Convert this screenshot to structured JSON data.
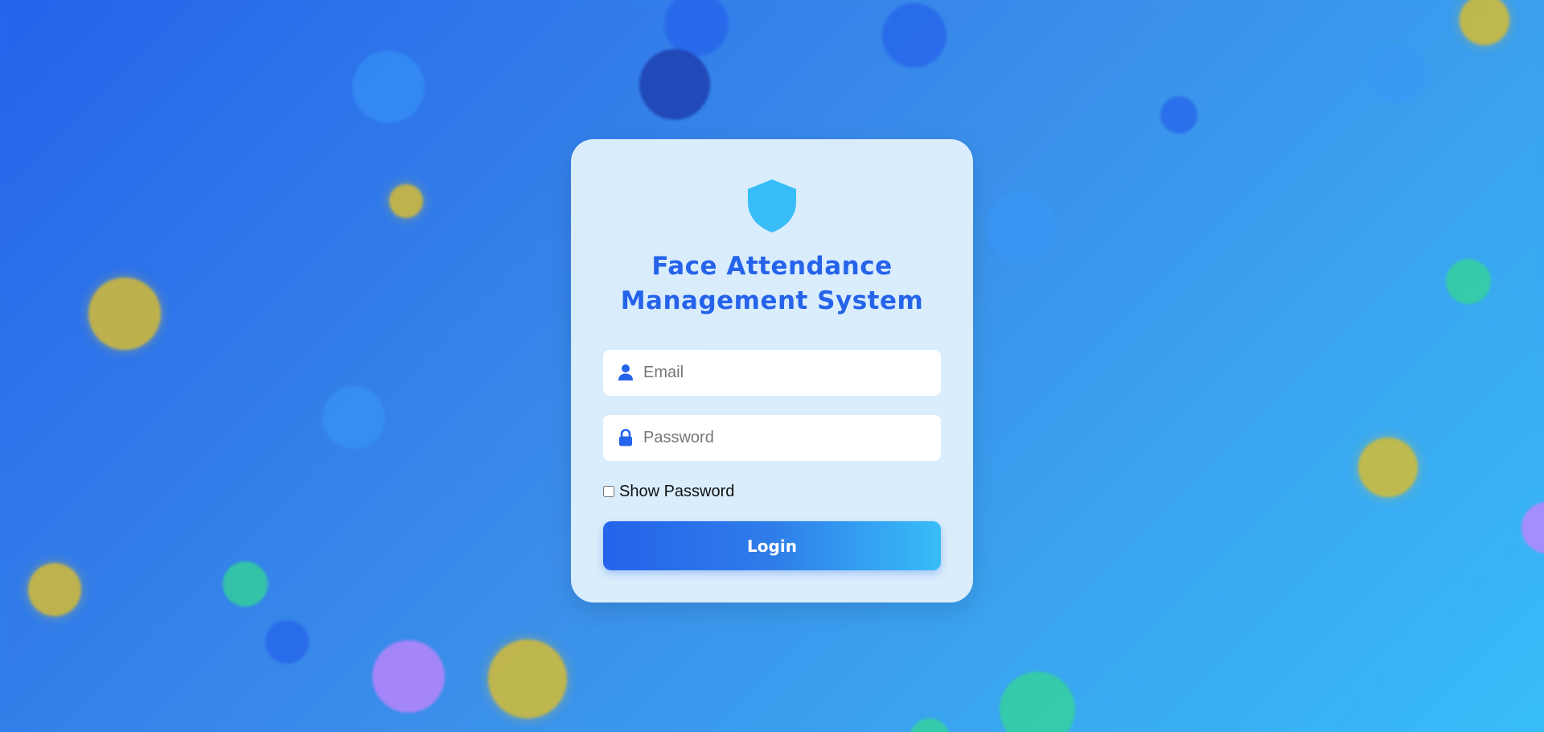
{
  "app": {
    "title_line1": "Face Attendance",
    "title_line2": "Management System",
    "logo_icon": "shield-icon"
  },
  "form": {
    "email": {
      "placeholder": "Email",
      "value": "",
      "icon": "user-icon"
    },
    "password": {
      "placeholder": "Password",
      "value": "",
      "icon": "lock-icon"
    },
    "show_password": {
      "label": "Show Password",
      "checked": false
    },
    "login_label": "Login"
  },
  "colors": {
    "accent": "#2563eb",
    "accent_light": "#38bdf8",
    "card_background": "#e0f0fc"
  }
}
